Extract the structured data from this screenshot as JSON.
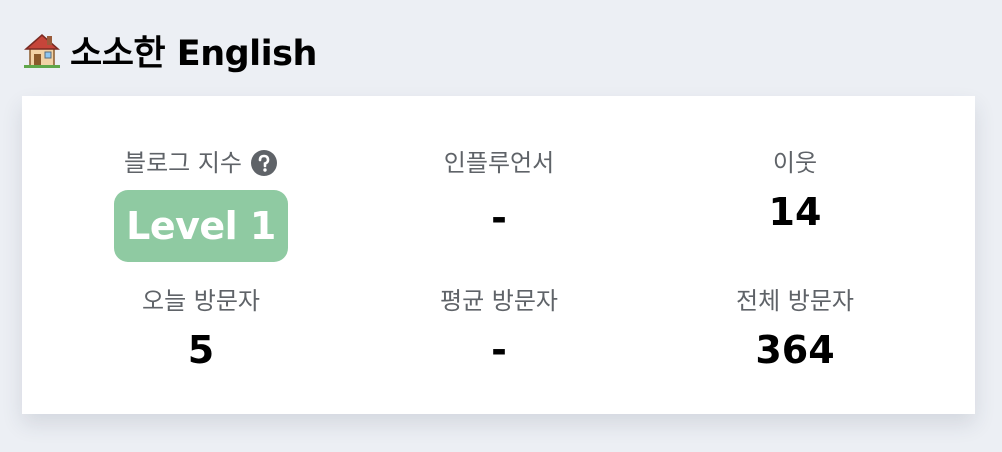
{
  "header": {
    "title": "소소한 English",
    "icon": "house-icon"
  },
  "stats": {
    "blog_index": {
      "label": "블로그 지수",
      "help_icon": "question-circle-icon",
      "badge": "Level 1",
      "badge_color": "#8fcaa2"
    },
    "influencer": {
      "label": "인플루언서",
      "value": "-"
    },
    "neighbors": {
      "label": "이웃",
      "value": "14"
    },
    "today_visitors": {
      "label": "오늘 방문자",
      "value": "5"
    },
    "average_visitors": {
      "label": "평균 방문자",
      "value": "-"
    },
    "total_visitors": {
      "label": "전체 방문자",
      "value": "364"
    }
  }
}
